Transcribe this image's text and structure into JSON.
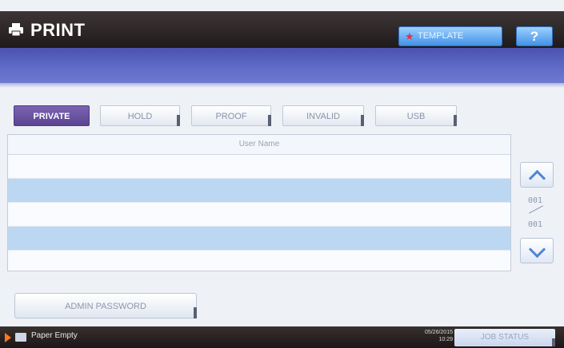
{
  "header": {
    "title": "PRINT",
    "template_label": "TEMPLATE",
    "help_label": "?"
  },
  "tabs": [
    {
      "label": "PRIVATE",
      "active": true
    },
    {
      "label": "HOLD",
      "active": false
    },
    {
      "label": "PROOF",
      "active": false
    },
    {
      "label": "INVALID",
      "active": false
    },
    {
      "label": "USB",
      "active": false
    }
  ],
  "table": {
    "column_header": "User Name",
    "rows": [
      "",
      "",
      "",
      "",
      ""
    ]
  },
  "pager": {
    "current": "001",
    "total": "001"
  },
  "admin_button_label": "ADMIN PASSWORD",
  "status": {
    "message": "Paper Empty",
    "date": "05/26/2015",
    "time": "10:29",
    "job_status_label": "JOB STATUS"
  },
  "colors": {
    "accent_tab": "#6a55a3",
    "band": "#5560ba",
    "row_shade": "#bcd7f2",
    "help_button": "#3f8fe6"
  }
}
